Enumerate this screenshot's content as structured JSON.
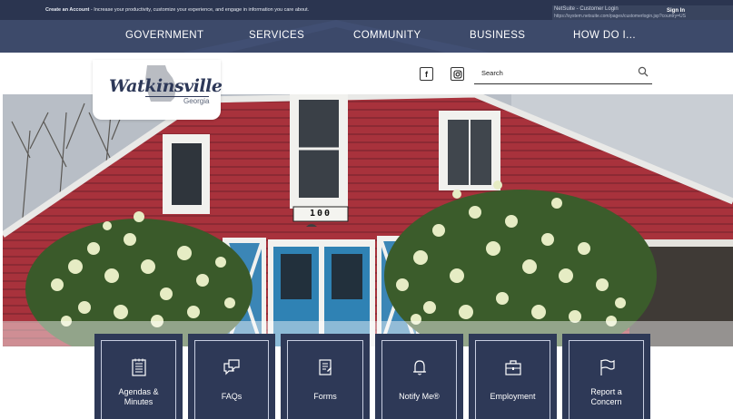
{
  "topbar": {
    "account_link": "Create an Account",
    "account_text": " - Increase your productivity, customize your experience, and engage in information you care about.",
    "autofill_title": "NetSuite - Customer Login",
    "autofill_url": "https://system.netsuite.com/pages/customerlogin.jsp?country=US",
    "signin_label": "Sign In"
  },
  "nav": {
    "items": [
      {
        "label": "GOVERNMENT"
      },
      {
        "label": "SERVICES"
      },
      {
        "label": "COMMUNITY"
      },
      {
        "label": "BUSINESS"
      },
      {
        "label": "HOW DO I..."
      }
    ]
  },
  "logo": {
    "name": "Watkinsville",
    "state": "Georgia"
  },
  "social": {
    "facebook_glyph": "f",
    "instagram_icon": "instagram-icon"
  },
  "search": {
    "placeholder": "Search",
    "icon": "search-icon"
  },
  "hero": {
    "sign_number": "100"
  },
  "tiles": [
    {
      "label_line1": "Agendas &",
      "label_line2": "Minutes",
      "icon": "agenda-icon"
    },
    {
      "label_line1": "FAQs",
      "label_line2": "",
      "icon": "chat-bubbles-icon"
    },
    {
      "label_line1": "Forms",
      "label_line2": "",
      "icon": "form-icon"
    },
    {
      "label_line1": "Notify Me®",
      "label_line2": "",
      "icon": "bell-icon"
    },
    {
      "label_line1": "Employment",
      "label_line2": "",
      "icon": "briefcase-icon"
    },
    {
      "label_line1": "Report a",
      "label_line2": "Concern",
      "icon": "flag-icon"
    }
  ],
  "colors": {
    "topbar_bg": "#2b3550",
    "nav_bg": "#3d4a6a",
    "tile_bg": "#2e3957",
    "barn_red": "#b3353f"
  }
}
